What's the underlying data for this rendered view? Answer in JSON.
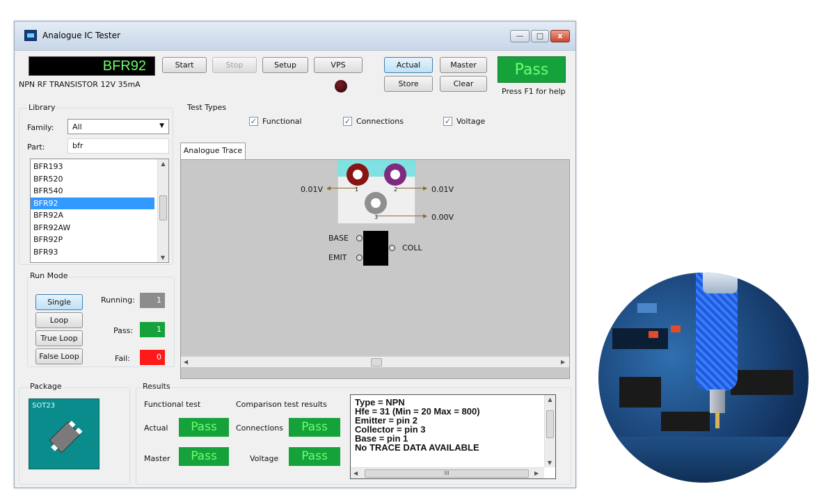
{
  "window": {
    "title": "Analogue IC Tester",
    "min": "—",
    "max": "□",
    "close": "x"
  },
  "header": {
    "device": "BFR92",
    "description": "NPN RF TRANSISTOR 12V 35mA",
    "start": "Start",
    "stop": "Stop",
    "setup": "Setup",
    "vps": "VPS",
    "actual": "Actual",
    "master": "Master",
    "store": "Store",
    "clear": "Clear",
    "result": "Pass",
    "help": "Press F1 for help"
  },
  "library": {
    "title": "Library",
    "family_label": "Family:",
    "family_value": "All",
    "part_label": "Part:",
    "part_value": "bfr",
    "items": [
      "BFR193",
      "BFR520",
      "BFR540",
      "BFR92",
      "BFR92A",
      "BFR92AW",
      "BFR92P",
      "BFR93"
    ],
    "selected": "BFR92"
  },
  "test_types": {
    "title": "Test Types",
    "functional": "Functional",
    "connections": "Connections",
    "voltage": "Voltage",
    "check": "✓"
  },
  "tab": {
    "label": "Analogue Trace"
  },
  "trace": {
    "pin1_voltage": "0.01V",
    "pin2_voltage": "0.01V",
    "pin3_voltage": "0.00V",
    "pin1": "1",
    "pin2": "2",
    "pin3": "3",
    "base": "BASE",
    "emit": "EMIT",
    "coll": "COLL"
  },
  "run_mode": {
    "title": "Run Mode",
    "single": "Single",
    "loop": "Loop",
    "true_loop": "True Loop",
    "false_loop": "False Loop",
    "running_label": "Running:",
    "running_value": "1",
    "pass_label": "Pass:",
    "pass_value": "1",
    "fail_label": "Fail:",
    "fail_value": "0"
  },
  "package": {
    "title": "Package",
    "name": "SOT23"
  },
  "results": {
    "title": "Results",
    "functional_heading": "Functional test",
    "comparison_heading": "Comparison test results",
    "actual_label": "Actual",
    "actual_value": "Pass",
    "master_label": "Master",
    "master_value": "Pass",
    "connections_label": "Connections",
    "connections_value": "Pass",
    "voltage_label": "Voltage",
    "voltage_value": "Pass",
    "text_lines": [
      "Type = NPN",
      "Hfe = 31 (Min = 20 Max = 800)",
      "Emitter = pin 2",
      "Collector = pin 3",
      "Base = pin 1",
      "No TRACE DATA AVAILABLE"
    ],
    "hscroll_thumb": "III"
  },
  "colors": {
    "pass_green": "#15a23a",
    "fail_red": "#ff1a1a",
    "running_gray": "#8c8c8c",
    "package_teal": "#0a8c8c",
    "selection_blue": "#3399ff"
  }
}
